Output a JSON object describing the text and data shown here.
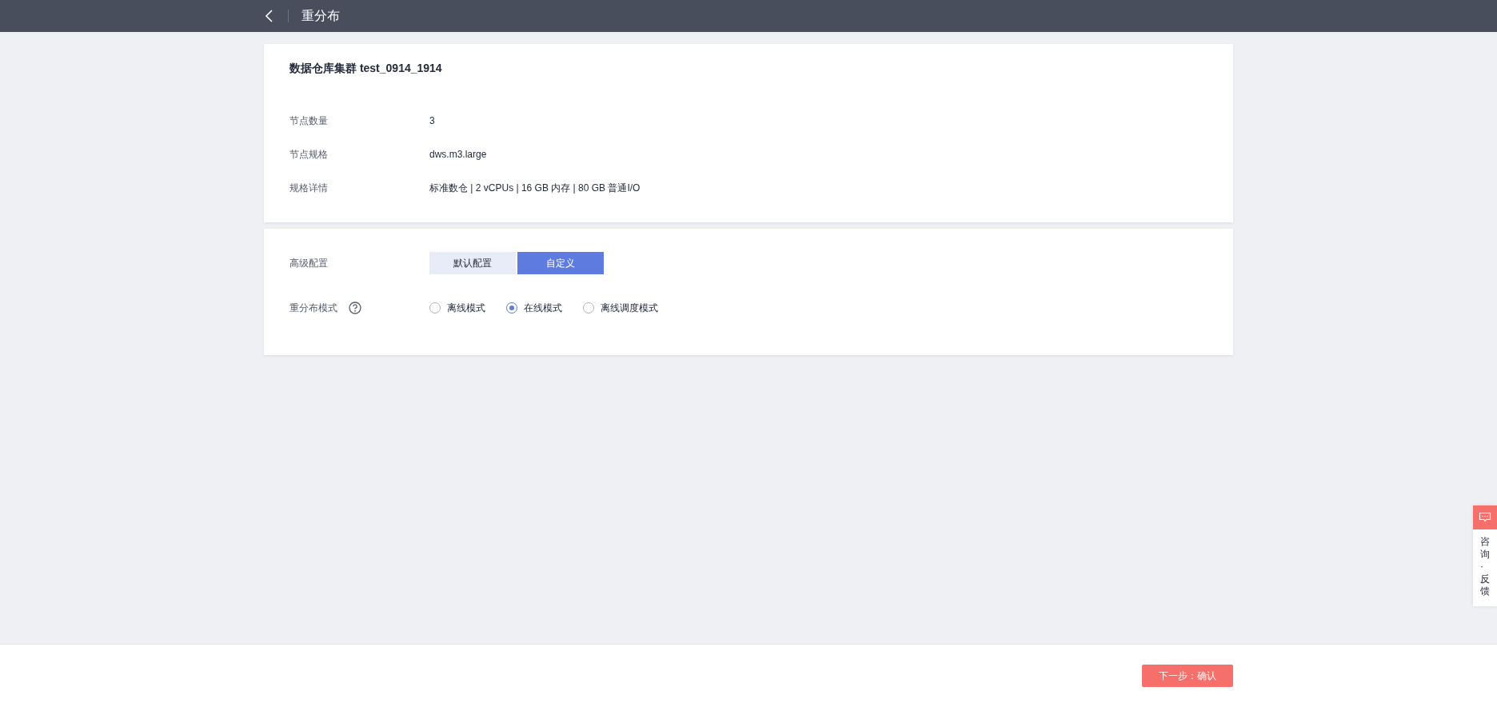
{
  "header": {
    "title": "重分布"
  },
  "cluster_card": {
    "title": "数据仓库集群 test_0914_1914",
    "fields": [
      {
        "label": "节点数量",
        "value": "3"
      },
      {
        "label": "节点规格",
        "value": "dws.m3.large"
      },
      {
        "label": "规格详情",
        "value": "标准数仓 | 2 vCPUs | 16 GB 内存 | 80 GB 普通I/O"
      }
    ]
  },
  "config_card": {
    "advanced_label": "高级配置",
    "advanced_options": [
      {
        "label": "默认配置",
        "selected": false
      },
      {
        "label": "自定义",
        "selected": true
      }
    ],
    "mode_label": "重分布模式",
    "modes": [
      {
        "label": "离线模式",
        "selected": false
      },
      {
        "label": "在线模式",
        "selected": true
      },
      {
        "label": "离线调度模式",
        "selected": false
      }
    ]
  },
  "feedback": {
    "label": "咨询·反馈"
  },
  "footer": {
    "next_button": "下一步：确认"
  }
}
